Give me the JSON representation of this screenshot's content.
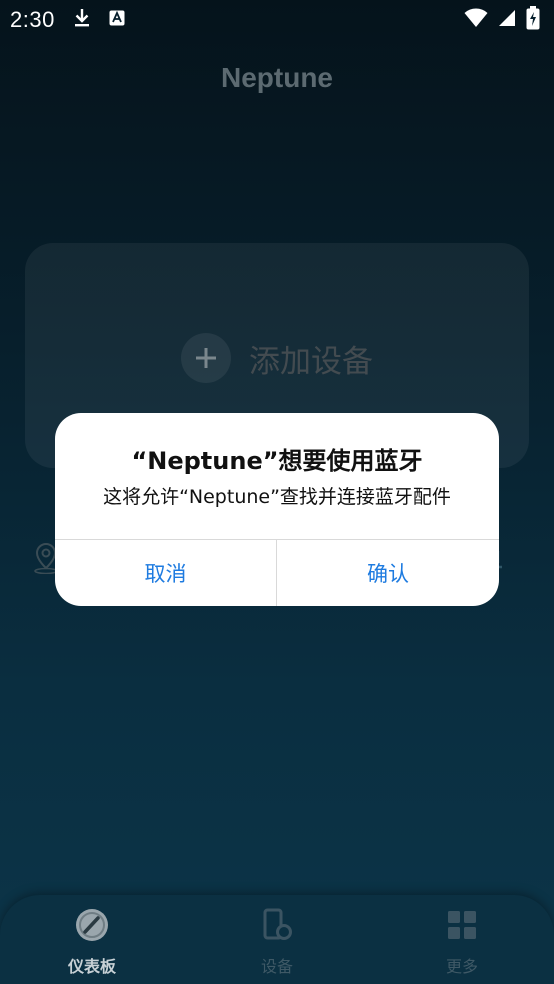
{
  "status_bar": {
    "time": "2:30"
  },
  "app": {
    "title": "Neptune"
  },
  "card": {
    "add_device_label": "添加设备"
  },
  "dialog": {
    "title": "“Neptune”想要使用蓝牙",
    "message": "这将允许“Neptune”查找并连接蓝牙配件",
    "cancel_label": "取消",
    "confirm_label": "确认",
    "accent_color": "#1e7be0"
  },
  "bottom_nav": {
    "items": [
      {
        "label": "仪表板",
        "icon": "dashboard-gauge-icon",
        "active": true
      },
      {
        "label": "设备",
        "icon": "device-icon",
        "active": false
      },
      {
        "label": "更多",
        "icon": "grid-more-icon",
        "active": false
      }
    ]
  }
}
